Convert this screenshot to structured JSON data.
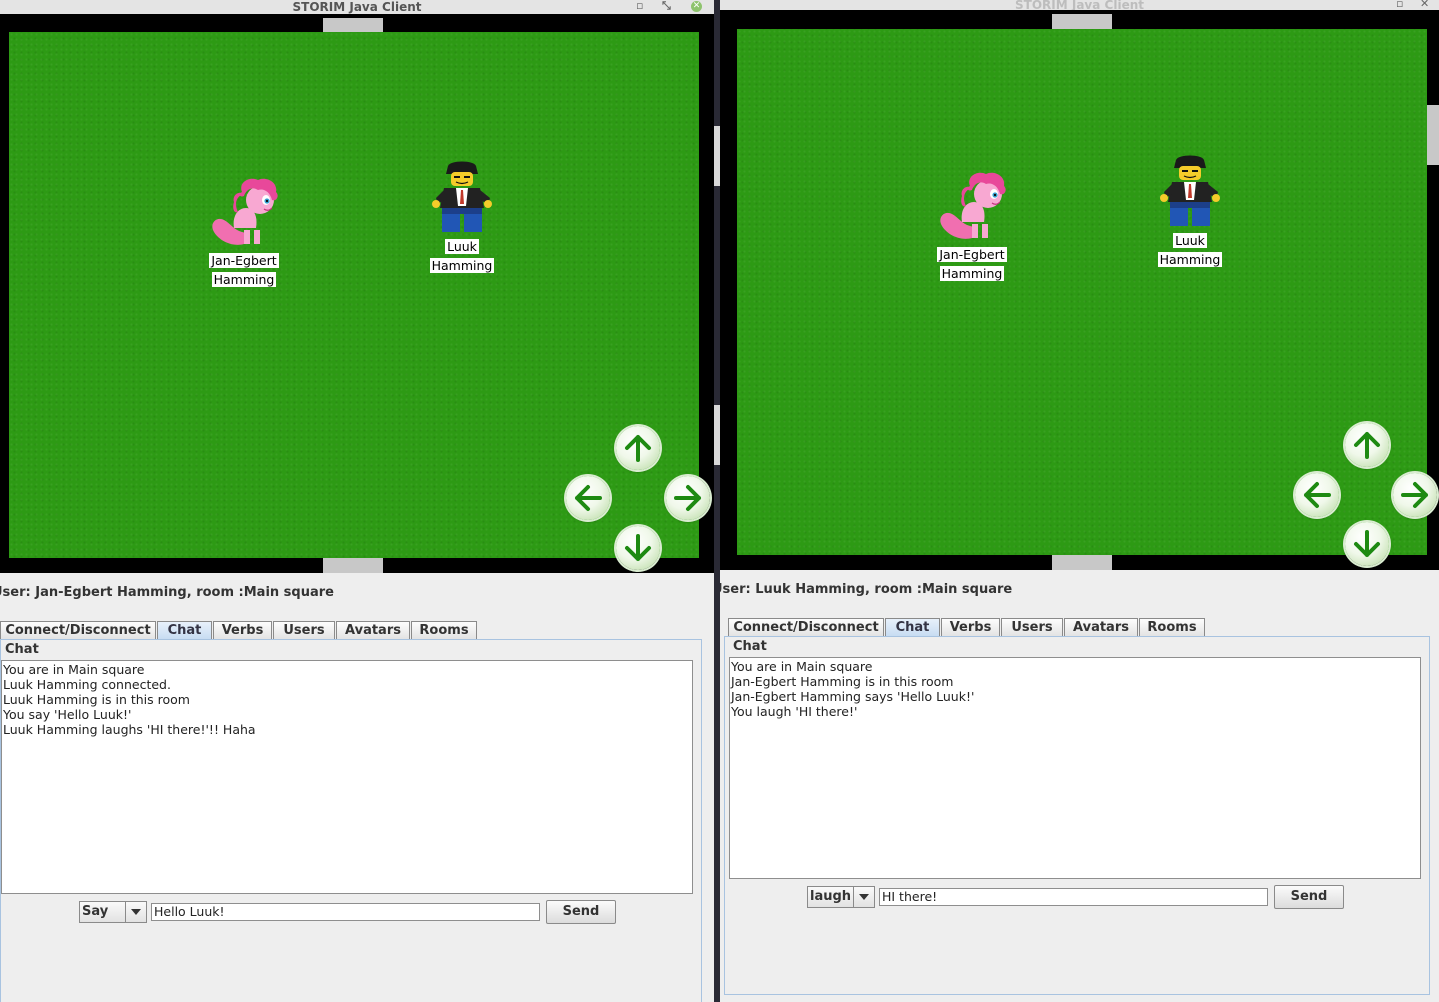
{
  "window1": {
    "title": "STORIM Java Client",
    "status": "User: Jan-Egbert Hamming, room :Main square",
    "tabs": [
      "Connect/Disconnect",
      "Chat",
      "Verbs",
      "Users",
      "Avatars",
      "Rooms"
    ],
    "active_tab": "Chat",
    "chat_label": "Chat",
    "chat_lines": [
      "You are in Main square",
      "Luuk Hamming connected.",
      "Luuk Hamming is in this room",
      "You say 'Hello Luuk!'",
      "Luuk Hamming laughs 'HI there!'!! Haha"
    ],
    "verb": "Say",
    "message": "Hello Luuk! ",
    "send_label": "Send",
    "avatars": [
      {
        "name_line1": "Jan-Egbert",
        "name_line2": "Hamming",
        "kind": "pink-pony"
      },
      {
        "name_line1": "Luuk",
        "name_line2": "Hamming",
        "kind": "lego-minifig"
      }
    ]
  },
  "window2": {
    "title": "STORIM Java Client",
    "status": "User: Luuk Hamming, room :Main square",
    "tabs": [
      "Connect/Disconnect",
      "Chat",
      "Verbs",
      "Users",
      "Avatars",
      "Rooms"
    ],
    "active_tab": "Chat",
    "chat_label": "Chat",
    "chat_lines": [
      "You are in Main square",
      "Jan-Egbert Hamming is in this room",
      "Jan-Egbert Hamming says 'Hello Luuk!'",
      "You laugh 'HI there!'"
    ],
    "verb": "laugh",
    "message": "HI there!",
    "send_label": "Send",
    "avatars": [
      {
        "name_line1": "Jan-Egbert",
        "name_line2": "Hamming",
        "kind": "pink-pony"
      },
      {
        "name_line1": "Luuk",
        "name_line2": "Hamming",
        "kind": "lego-minifig"
      }
    ]
  },
  "icons": {
    "arrows": [
      "arrow-up-icon",
      "arrow-left-icon",
      "arrow-right-icon",
      "arrow-down-icon"
    ],
    "combo": "chevron-down-icon"
  },
  "colors": {
    "grass": "#2d9a14",
    "arrow_green": "#1e8a12",
    "active_tab": "#c7dcf2",
    "panel_border": "#a8c3e0"
  }
}
